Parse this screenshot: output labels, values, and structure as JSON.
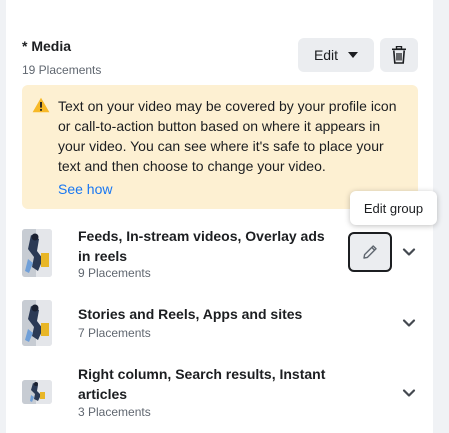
{
  "media": {
    "title": "* Media",
    "placements": "19 Placements",
    "edit_label": "Edit"
  },
  "warning": {
    "text": "Text on your video may be covered by your profile icon or call-to-action button based on where it appears in your video. You can see where it's safe to place your text and then choose to change your video.",
    "link": "See how"
  },
  "tooltip": "Edit group",
  "groups": [
    {
      "title": "Feeds, In-stream videos, Overlay ads in reels",
      "placements": "9 Placements"
    },
    {
      "title": "Stories and Reels, Apps and sites",
      "placements": "7 Placements"
    },
    {
      "title": "Right column, Search results, Instant articles",
      "placements": "3 Placements"
    }
  ],
  "colors": {
    "warning_bg": "#fdf0d2",
    "warning_icon": "#f7b928",
    "link": "#1877f2"
  },
  "icons": [
    "caret-down-icon",
    "trash-icon",
    "warning-icon",
    "pencil-icon",
    "chevron-down-icon"
  ]
}
